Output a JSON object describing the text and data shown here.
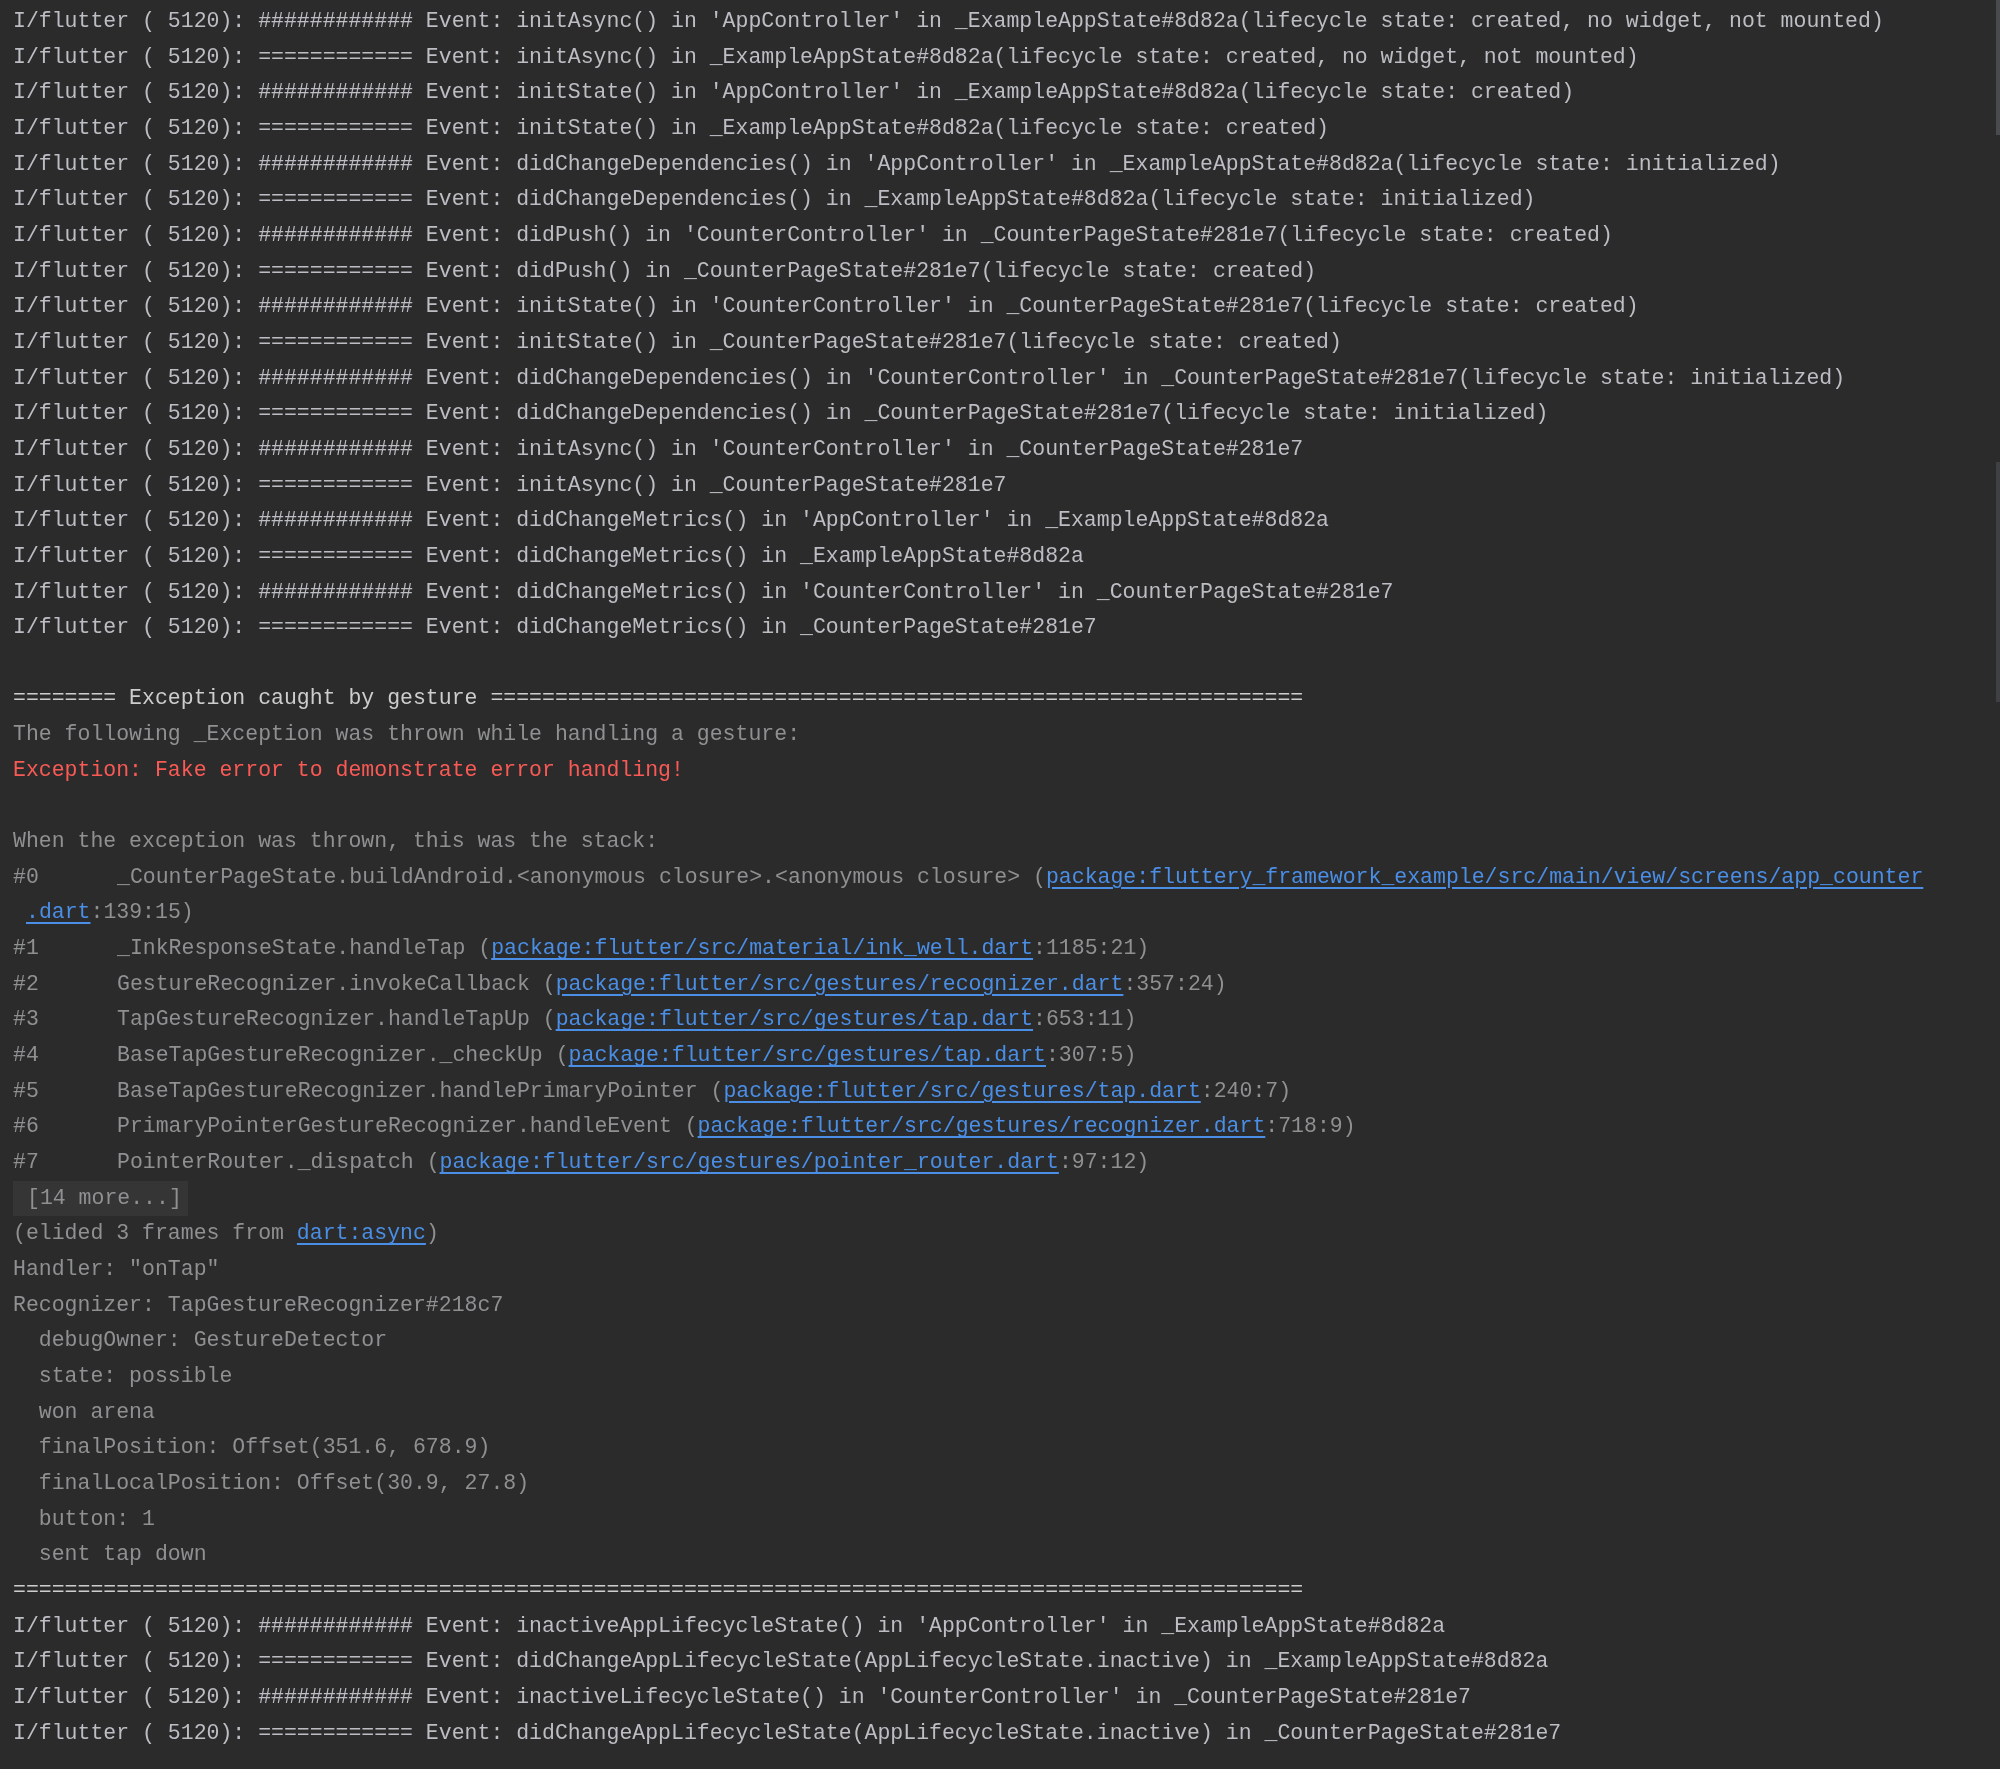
{
  "console": {
    "lines": [
      {
        "kind": "log",
        "parts": [
          {
            "text": "I/flutter ( 5120): ############ Event: initAsync() in 'AppController' in _ExampleAppState#8d82a(lifecycle state: created, no widget, not mounted)",
            "link": false
          }
        ]
      },
      {
        "kind": "log",
        "parts": [
          {
            "text": "I/flutter ( 5120): ============ Event: initAsync() in _ExampleAppState#8d82a(lifecycle state: created, no widget, not mounted)",
            "link": false
          }
        ]
      },
      {
        "kind": "log",
        "parts": [
          {
            "text": "I/flutter ( 5120): ############ Event: initState() in 'AppController' in _ExampleAppState#8d82a(lifecycle state: created)",
            "link": false
          }
        ]
      },
      {
        "kind": "log",
        "parts": [
          {
            "text": "I/flutter ( 5120): ============ Event: initState() in _ExampleAppState#8d82a(lifecycle state: created)",
            "link": false
          }
        ]
      },
      {
        "kind": "log",
        "parts": [
          {
            "text": "I/flutter ( 5120): ############ Event: didChangeDependencies() in 'AppController' in _ExampleAppState#8d82a(lifecycle state: initialized)",
            "link": false
          }
        ]
      },
      {
        "kind": "log",
        "parts": [
          {
            "text": "I/flutter ( 5120): ============ Event: didChangeDependencies() in _ExampleAppState#8d82a(lifecycle state: initialized)",
            "link": false
          }
        ]
      },
      {
        "kind": "log",
        "parts": [
          {
            "text": "I/flutter ( 5120): ############ Event: didPush() in 'CounterController' in _CounterPageState#281e7(lifecycle state: created)",
            "link": false
          }
        ]
      },
      {
        "kind": "log",
        "parts": [
          {
            "text": "I/flutter ( 5120): ============ Event: didPush() in _CounterPageState#281e7(lifecycle state: created)",
            "link": false
          }
        ]
      },
      {
        "kind": "log",
        "parts": [
          {
            "text": "I/flutter ( 5120): ############ Event: initState() in 'CounterController' in _CounterPageState#281e7(lifecycle state: created)",
            "link": false
          }
        ]
      },
      {
        "kind": "log",
        "parts": [
          {
            "text": "I/flutter ( 5120): ============ Event: initState() in _CounterPageState#281e7(lifecycle state: created)",
            "link": false
          }
        ]
      },
      {
        "kind": "log",
        "parts": [
          {
            "text": "I/flutter ( 5120): ############ Event: didChangeDependencies() in 'CounterController' in _CounterPageState#281e7(lifecycle state: initialized)",
            "link": false
          }
        ]
      },
      {
        "kind": "log",
        "parts": [
          {
            "text": "I/flutter ( 5120): ============ Event: didChangeDependencies() in _CounterPageState#281e7(lifecycle state: initialized)",
            "link": false
          }
        ]
      },
      {
        "kind": "log",
        "parts": [
          {
            "text": "I/flutter ( 5120): ############ Event: initAsync() in 'CounterController' in _CounterPageState#281e7",
            "link": false
          }
        ]
      },
      {
        "kind": "log",
        "parts": [
          {
            "text": "I/flutter ( 5120): ============ Event: initAsync() in _CounterPageState#281e7",
            "link": false
          }
        ]
      },
      {
        "kind": "log",
        "parts": [
          {
            "text": "I/flutter ( 5120): ############ Event: didChangeMetrics() in 'AppController' in _ExampleAppState#8d82a",
            "link": false
          }
        ]
      },
      {
        "kind": "log",
        "parts": [
          {
            "text": "I/flutter ( 5120): ============ Event: didChangeMetrics() in _ExampleAppState#8d82a",
            "link": false
          }
        ]
      },
      {
        "kind": "log",
        "parts": [
          {
            "text": "I/flutter ( 5120): ############ Event: didChangeMetrics() in 'CounterController' in _CounterPageState#281e7",
            "link": false
          }
        ]
      },
      {
        "kind": "log",
        "parts": [
          {
            "text": "I/flutter ( 5120): ============ Event: didChangeMetrics() in _CounterPageState#281e7",
            "link": false
          }
        ]
      },
      {
        "kind": "blank"
      },
      {
        "kind": "header",
        "parts": [
          {
            "text": "======== Exception caught by gesture ===============================================================",
            "link": false
          }
        ]
      },
      {
        "kind": "muted",
        "parts": [
          {
            "text": "The following _Exception was thrown while handling a gesture:",
            "link": false
          }
        ]
      },
      {
        "kind": "error",
        "parts": [
          {
            "text": "Exception: Fake error to demonstrate error handling!",
            "link": false
          }
        ]
      },
      {
        "kind": "blank"
      },
      {
        "kind": "muted",
        "parts": [
          {
            "text": "When the exception was thrown, this was the stack:",
            "link": false
          }
        ]
      },
      {
        "kind": "frame",
        "index": "#0",
        "parts": [
          {
            "text": "_CounterPageState.buildAndroid.<anonymous closure>.<anonymous closure> (",
            "link": false
          },
          {
            "text": "package:fluttery_framework_example/src/main/view/screens/app_counter",
            "link": true
          }
        ]
      },
      {
        "kind": "cont",
        "parts": [
          {
            "text": ".dart",
            "link": true
          },
          {
            "text": ":139:15)",
            "link": false
          }
        ]
      },
      {
        "kind": "frame",
        "index": "#1",
        "parts": [
          {
            "text": "_InkResponseState.handleTap (",
            "link": false
          },
          {
            "text": "package:flutter/src/material/ink_well.dart",
            "link": true
          },
          {
            "text": ":1185:21)",
            "link": false
          }
        ]
      },
      {
        "kind": "frame",
        "index": "#2",
        "parts": [
          {
            "text": "GestureRecognizer.invokeCallback (",
            "link": false
          },
          {
            "text": "package:flutter/src/gestures/recognizer.dart",
            "link": true
          },
          {
            "text": ":357:24)",
            "link": false
          }
        ]
      },
      {
        "kind": "frame",
        "index": "#3",
        "parts": [
          {
            "text": "TapGestureRecognizer.handleTapUp (",
            "link": false
          },
          {
            "text": "package:flutter/src/gestures/tap.dart",
            "link": true
          },
          {
            "text": ":653:11)",
            "link": false
          }
        ]
      },
      {
        "kind": "frame",
        "index": "#4",
        "parts": [
          {
            "text": "BaseTapGestureRecognizer._checkUp (",
            "link": false
          },
          {
            "text": "package:flutter/src/gestures/tap.dart",
            "link": true
          },
          {
            "text": ":307:5)",
            "link": false
          }
        ]
      },
      {
        "kind": "frame",
        "index": "#5",
        "parts": [
          {
            "text": "BaseTapGestureRecognizer.handlePrimaryPointer (",
            "link": false
          },
          {
            "text": "package:flutter/src/gestures/tap.dart",
            "link": true
          },
          {
            "text": ":240:7)",
            "link": false
          }
        ]
      },
      {
        "kind": "frame",
        "index": "#6",
        "parts": [
          {
            "text": "PrimaryPointerGestureRecognizer.handleEvent (",
            "link": false
          },
          {
            "text": "package:flutter/src/gestures/recognizer.dart",
            "link": true
          },
          {
            "text": ":718:9)",
            "link": false
          }
        ]
      },
      {
        "kind": "frame",
        "index": "#7",
        "parts": [
          {
            "text": "PointerRouter._dispatch (",
            "link": false
          },
          {
            "text": "package:flutter/src/gestures/pointer_router.dart",
            "link": true
          },
          {
            "text": ":97:12)",
            "link": false
          }
        ]
      },
      {
        "kind": "more",
        "parts": [
          {
            "text": "[14 more...]",
            "link": false
          }
        ]
      },
      {
        "kind": "muted",
        "parts": [
          {
            "text": "(elided 3 frames from ",
            "link": false
          },
          {
            "text": "dart:async",
            "link": true
          },
          {
            "text": ")",
            "link": false
          }
        ]
      },
      {
        "kind": "muted",
        "parts": [
          {
            "text": "Handler: \"onTap\"",
            "link": false
          }
        ]
      },
      {
        "kind": "muted",
        "parts": [
          {
            "text": "Recognizer: TapGestureRecognizer#218c7",
            "link": false
          }
        ]
      },
      {
        "kind": "muted",
        "parts": [
          {
            "text": "  debugOwner: GestureDetector",
            "link": false
          }
        ]
      },
      {
        "kind": "muted",
        "parts": [
          {
            "text": "  state: possible",
            "link": false
          }
        ]
      },
      {
        "kind": "muted",
        "parts": [
          {
            "text": "  won arena",
            "link": false
          }
        ]
      },
      {
        "kind": "muted",
        "parts": [
          {
            "text": "  finalPosition: Offset(351.6, 678.9)",
            "link": false
          }
        ]
      },
      {
        "kind": "muted",
        "parts": [
          {
            "text": "  finalLocalPosition: Offset(30.9, 27.8)",
            "link": false
          }
        ]
      },
      {
        "kind": "muted",
        "parts": [
          {
            "text": "  button: 1",
            "link": false
          }
        ]
      },
      {
        "kind": "muted",
        "parts": [
          {
            "text": "  sent tap down",
            "link": false
          }
        ]
      },
      {
        "kind": "header",
        "parts": [
          {
            "text": "====================================================================================================",
            "link": false
          }
        ]
      },
      {
        "kind": "log",
        "parts": [
          {
            "text": "I/flutter ( 5120): ############ Event: inactiveAppLifecycleState() in 'AppController' in _ExampleAppState#8d82a",
            "link": false
          }
        ]
      },
      {
        "kind": "log",
        "parts": [
          {
            "text": "I/flutter ( 5120): ============ Event: didChangeAppLifecycleState(AppLifecycleState.inactive) in _ExampleAppState#8d82a",
            "link": false
          }
        ]
      },
      {
        "kind": "log",
        "parts": [
          {
            "text": "I/flutter ( 5120): ############ Event: inactiveLifecycleState() in 'CounterController' in _CounterPageState#281e7",
            "link": false
          }
        ]
      },
      {
        "kind": "log",
        "parts": [
          {
            "text": "I/flutter ( 5120): ============ Event: didChangeAppLifecycleState(AppLifecycleState.inactive) in _CounterPageState#281e7",
            "link": false
          }
        ]
      }
    ]
  }
}
